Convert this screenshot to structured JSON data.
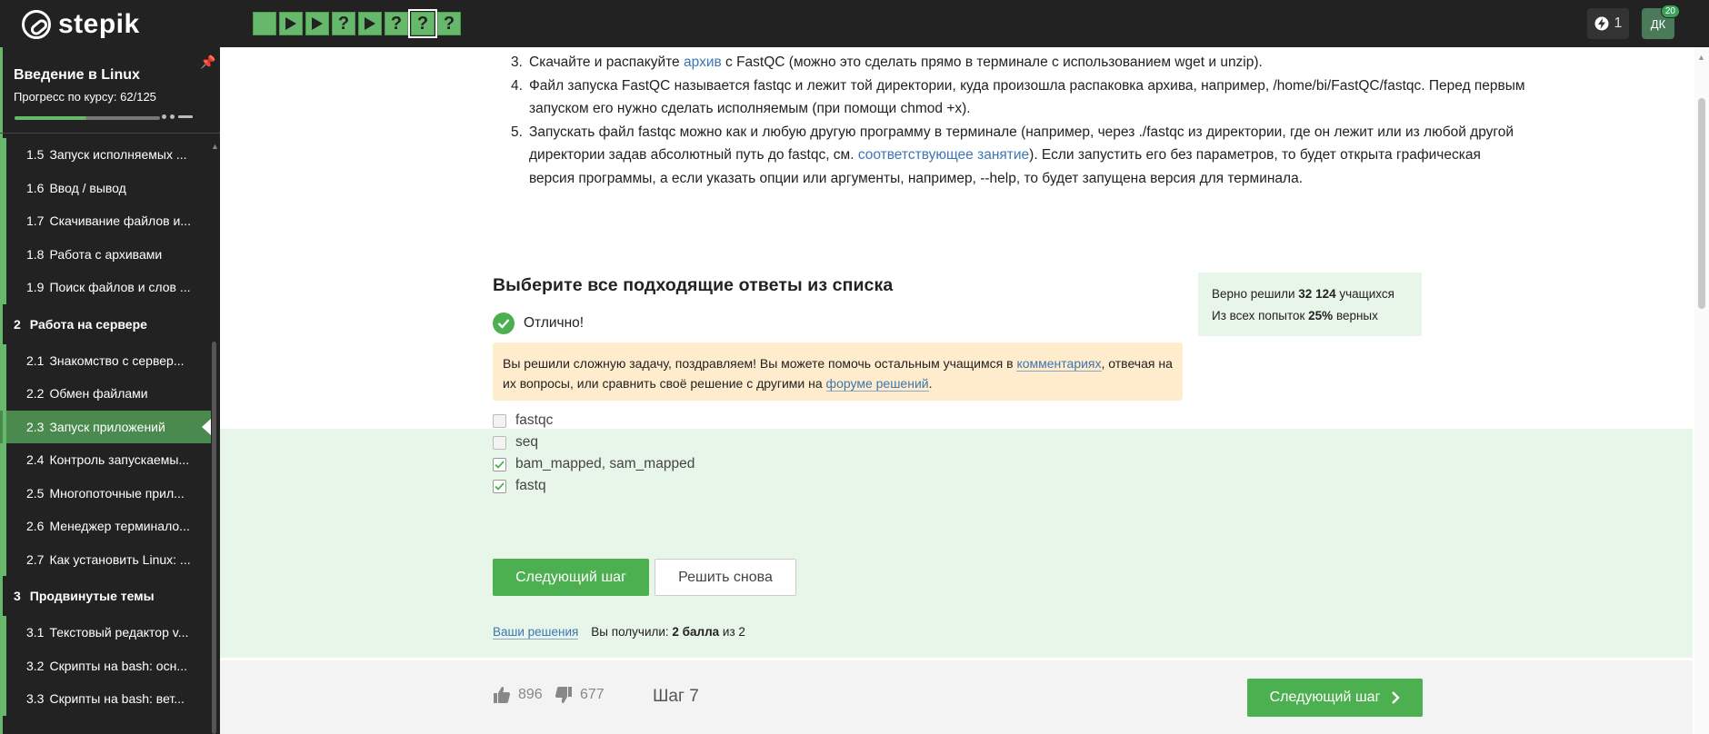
{
  "brand": {
    "name": "stepik"
  },
  "topbar": {
    "steps": [
      {
        "type": "square"
      },
      {
        "type": "play"
      },
      {
        "type": "play"
      },
      {
        "type": "question",
        "label": "?"
      },
      {
        "type": "play"
      },
      {
        "type": "question",
        "label": "?"
      },
      {
        "type": "question",
        "label": "?",
        "current": true
      },
      {
        "type": "question",
        "label": "?"
      }
    ],
    "energy_count": "1",
    "avatar_initials": "ДК",
    "avatar_badge": "20"
  },
  "sidebar": {
    "course_title": "Введение в Linux",
    "progress_label": "Прогресс по курсу:  62/125",
    "progress": 0.496,
    "items": [
      {
        "kind": "lesson",
        "num": "1.5",
        "label": "Запуск исполняемых ..."
      },
      {
        "kind": "lesson",
        "num": "1.6",
        "label": "Ввод / вывод"
      },
      {
        "kind": "lesson",
        "num": "1.7",
        "label": "Скачивание файлов и..."
      },
      {
        "kind": "lesson",
        "num": "1.8",
        "label": "Работа с архивами"
      },
      {
        "kind": "lesson",
        "num": "1.9",
        "label": "Поиск файлов и слов ..."
      },
      {
        "kind": "section",
        "num": "2",
        "label": "Работа на сервере"
      },
      {
        "kind": "lesson",
        "num": "2.1",
        "label": "Знакомство с сервер..."
      },
      {
        "kind": "lesson",
        "num": "2.2",
        "label": "Обмен файлами"
      },
      {
        "kind": "lesson",
        "num": "2.3",
        "label": "Запуск приложений",
        "active": true
      },
      {
        "kind": "lesson",
        "num": "2.4",
        "label": "Контроль запускаемы..."
      },
      {
        "kind": "lesson",
        "num": "2.5",
        "label": "Многопоточные прил..."
      },
      {
        "kind": "lesson",
        "num": "2.6",
        "label": "Менеджер терминало..."
      },
      {
        "kind": "lesson",
        "num": "2.7",
        "label": "Как установить Linux: ..."
      },
      {
        "kind": "section",
        "num": "3",
        "label": "Продвинутые темы"
      },
      {
        "kind": "lesson",
        "num": "3.1",
        "label": "Текстовый редактор v..."
      },
      {
        "kind": "lesson",
        "num": "3.2",
        "label": "Скрипты на bash: осн..."
      },
      {
        "kind": "lesson",
        "num": "3.3",
        "label": "Скрипты на bash: вет..."
      }
    ]
  },
  "instructions": {
    "item3": {
      "n": "3.",
      "pre": "Скачайте и распакуйте ",
      "link": "архив",
      "post": " с FastQC (можно это сделать прямо в терминале с использованием wget и unzip)."
    },
    "item4": {
      "n": "4.",
      "text": "Файл запуска FastQC называется fastqc и лежит той директории, куда произошла распаковка архива, например, /home/bi/FastQC/fastqc. Перед первым запуском его нужно сделать исполняемым (при помощи chmod +x)."
    },
    "item5": {
      "n": "5.",
      "pre": "Запускать файл fastqc можно как и любую другую программу в терминале (например, через ./fastqc из директории, где он лежит или из любой другой директории задав абсолютный путь до fastqc, см. ",
      "link": "соответствующее занятие",
      "post": "). Если запустить его без параметров, то будет открыта графическая версия программы, а если указать опции или аргументы, например, --help, то будет запущена версия для терминала."
    }
  },
  "quiz": {
    "title": "Выберите все подходящие ответы из списка",
    "stats": {
      "solved_pre": "Верно решили ",
      "solved_count": "32 124",
      "solved_post": " учащихся",
      "attempts_pre": "Из всех попыток ",
      "attempts_pct": "25%",
      "attempts_post": " верных"
    },
    "result": "Отлично!",
    "hint": {
      "pre": "Вы решили сложную задачу, поздравляем! Вы можете помочь остальным учащимся в ",
      "link1": "комментариях",
      "mid": ", отвечая на их вопросы, или сравнить своё решение с другими на ",
      "link2": "форуме решений",
      "post": "."
    },
    "options": [
      {
        "label": "fastqc",
        "checked": false
      },
      {
        "label": "seq",
        "checked": false
      },
      {
        "label": "bam_mapped, sam_mapped",
        "checked": true
      },
      {
        "label": "fastq",
        "checked": true
      }
    ],
    "next_label": "Следующий шаг",
    "retry_label": "Решить снова",
    "solutions_link": "Ваши решения",
    "score_pre": "Вы получили: ",
    "score_value": "2 балла",
    "score_post": " из 2"
  },
  "footer": {
    "likes": "896",
    "dislikes": "677",
    "step_label": "Шаг 7",
    "next_label": "Следующий шаг"
  },
  "colors": {
    "accent": "#4caf50",
    "topbar": "#222222",
    "link": "#3d76b3",
    "hint_bg": "#ffeccc",
    "success_bg": "#e8f5e9"
  }
}
